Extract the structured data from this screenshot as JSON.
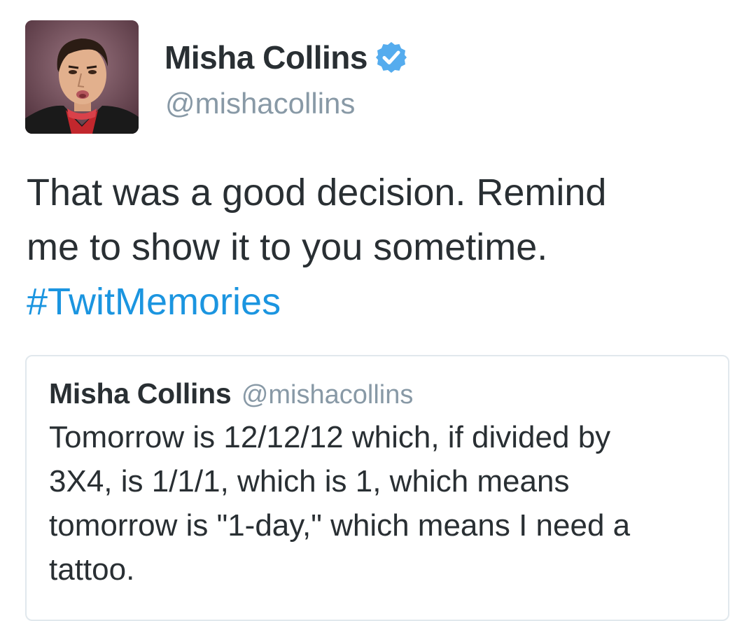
{
  "tweet": {
    "author": {
      "name": "Misha Collins",
      "handle": "@mishacollins",
      "verified": true,
      "avatar_icon": "profile-photo"
    },
    "text_lines": [
      "That was a good decision. Remind",
      "me to show it to you sometime."
    ],
    "hashtag": "#TwitMemories",
    "quoted_tweet": {
      "name": "Misha Collins",
      "handle": "@mishacollins",
      "text_lines": [
        "Tomorrow is 12/12/12 which, if divided by",
        "3X4, is 1/1/1, which is 1, which means",
        "tomorrow is \"1-day,\" which means I need a",
        "tattoo."
      ]
    }
  },
  "colors": {
    "text": "#292f33",
    "secondary": "#8899a6",
    "link": "#1b95e0",
    "verified": "#55acee",
    "border": "#e1e8ed"
  }
}
